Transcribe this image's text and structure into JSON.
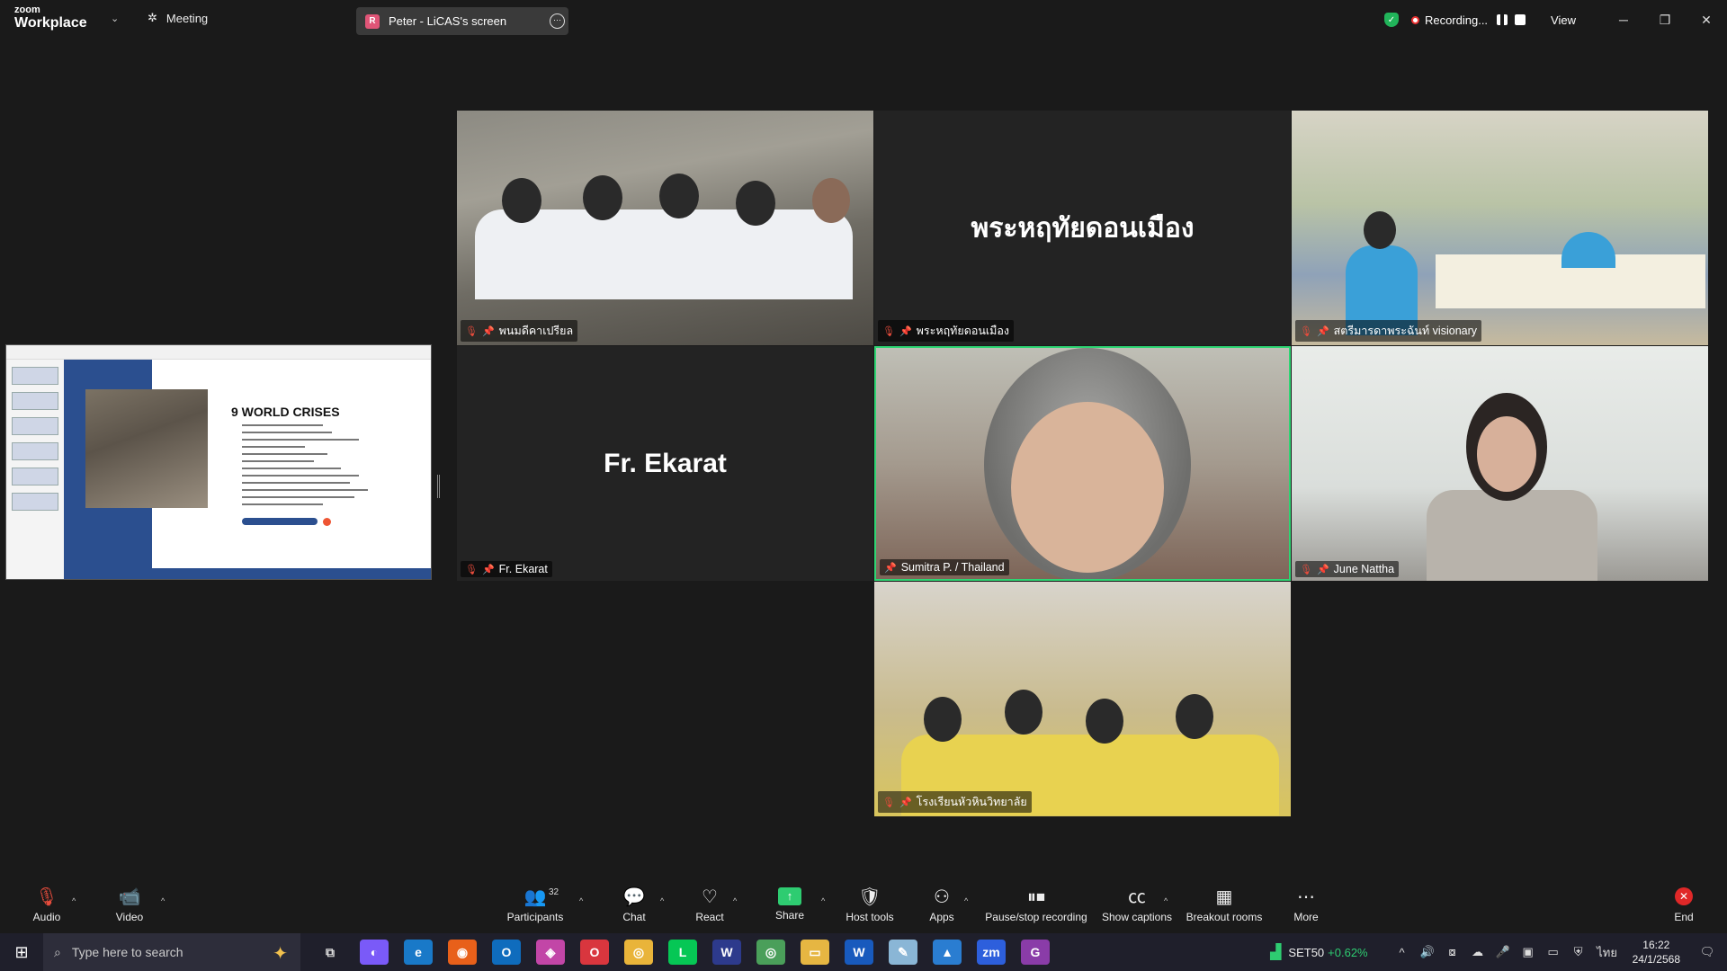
{
  "app": {
    "brand": "zoom",
    "product": "Workplace",
    "meeting_label": "Meeting",
    "share_badge": "R",
    "share_title": "Peter - LiCAS's screen",
    "recording_label": "Recording...",
    "view_label": "View"
  },
  "tiles": [
    {
      "name": "พนมดีคาเปรียล",
      "muted": true
    },
    {
      "name": "พระหฤทัยดอนเมือง",
      "big": "พระหฤทัยดอนเมือง",
      "muted": true
    },
    {
      "name": "สตรีมารดาพระฉันท์ visionary",
      "muted": true
    },
    {
      "name": "Fr. Ekarat",
      "big": "Fr. Ekarat",
      "muted": true
    },
    {
      "name": "Sumitra P. / Thailand",
      "muted": false,
      "active": true
    },
    {
      "name": "June Nattha",
      "muted": true
    },
    {
      "name": "โรงเรียนหัวหินวิทยาลัย",
      "muted": true
    }
  ],
  "shared_slide": {
    "title": "9 WORLD CRISES"
  },
  "toolbar": {
    "audio": "Audio",
    "video": "Video",
    "participants": "Participants",
    "participant_count": "32",
    "chat": "Chat",
    "react": "React",
    "share": "Share",
    "host_tools": "Host tools",
    "apps": "Apps",
    "pause_stop_recording": "Pause/stop recording",
    "show_captions": "Show captions",
    "breakout_rooms": "Breakout rooms",
    "more": "More",
    "end": "End"
  },
  "taskbar": {
    "search_placeholder": "Type here to search",
    "ticker": "SET50",
    "ticker_change": "+0.62%",
    "ime": "ไทย",
    "time": "16:22",
    "date": "24/1/2568"
  },
  "colors": {
    "active_speaker": "#2ed573",
    "muted_icon": "#e74c3c",
    "share_green": "#2ecc71",
    "end_red": "#e02828"
  }
}
